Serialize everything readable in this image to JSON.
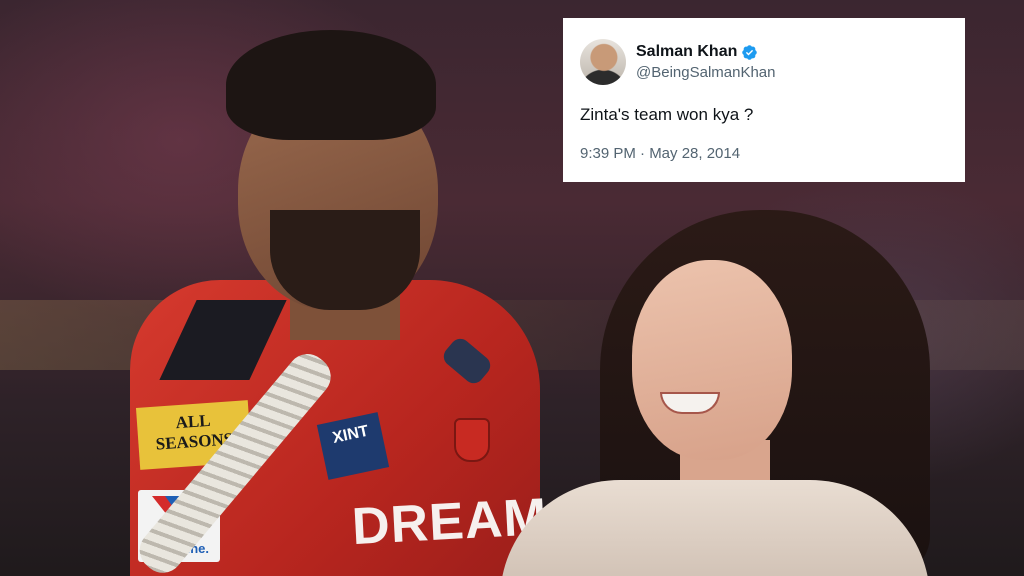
{
  "tweet": {
    "name": "Salman Khan",
    "handle": "@BeingSalmanKhan",
    "text": "Zinta's team won kya ?",
    "timestamp": "9:39 PM · May 28, 2014",
    "verified": true,
    "verified_color": "#1d9bf0"
  },
  "photo": {
    "jersey_texts": {
      "all_seasons": "ALL SEASONS",
      "valvoline": "Valvoline.",
      "xint": "XINT",
      "dream": "DREAM"
    },
    "jersey_color": "#c62d24"
  }
}
